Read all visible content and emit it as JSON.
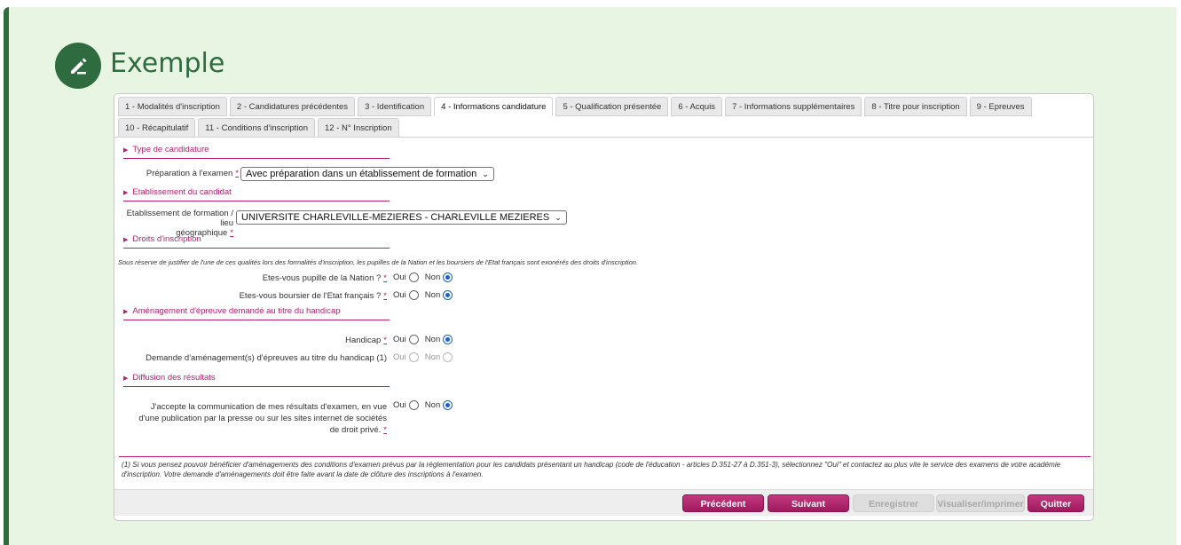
{
  "callout": {
    "title": "Exemple",
    "icon": "pencil-icon"
  },
  "tabs": [
    [
      "1 - Modalités d'inscription",
      "2 - Candidatures précédentes",
      "3 - Identification",
      "4 - Informations candidature",
      "5 - Qualification présentée",
      "6 - Acquis",
      "7 - Informations supplémentaires",
      "8 - Titre pour inscription",
      "9 - Epreuves"
    ],
    [
      "10 - Récapitulatif",
      "11 - Conditions d'inscription",
      "12 - N° Inscription"
    ]
  ],
  "active_tab": "4 - Informations candidature",
  "sections": {
    "type": "Type de candidature",
    "etab": "Etablissement du candidat",
    "droits": "Droits d'inscription",
    "amenagement": "Aménagement d'épreuve demandé au titre du handicap",
    "diffusion": "Diffusion des résultats"
  },
  "fields": {
    "preparation_label": "Préparation à l'examen",
    "preparation_value": "Avec préparation dans un établissement de formation",
    "etab_label_1": "Etablissement de formation / lieu",
    "etab_label_2": "géographique",
    "etab_value": "UNIVERSITE CHARLEVILLE-MEZIERES - CHARLEVILLE MEZIERES",
    "droits_note": "Sous réserve de justifier de l'une de ces qualités lors des formalités d'inscription, les pupilles de la Nation et les boursiers de l'Etat français sont exonérés des droits d'inscription.",
    "pupille_label": "Etes-vous pupille de la Nation ?",
    "boursier_label": "Etes-vous boursier de l'Etat français ?",
    "handicap_label": "Handicap",
    "demande_label": "Demande d'aménagement(s) d'épreuves au titre du handicap (1)",
    "diffusion_label_1": "J'accepte la communication de mes résultats d'examen, en vue",
    "diffusion_label_2": "d'une publication par la presse ou sur les sites internet de sociétés",
    "diffusion_label_3": "de droit privé."
  },
  "radio": {
    "oui": "Oui",
    "non": "Non",
    "required_mark": "*"
  },
  "footnote": "(1) Si vous pensez pouvoir bénéficier d'aménagements des conditions d'examen prévus par la réglementation pour les candidats présentant un handicap (code de l'éducation - articles D.351-27 à D.351-3), sélectionnez \"Oui\" et contactez au plus vite le service des examens de votre académie d'inscription. Votre demande d'aménagements doit être faite avant la date de clôture des inscriptions à l'examen.",
  "buttons": {
    "prev": "Précédent",
    "next": "Suivant",
    "save": "Enregistrer",
    "print": "Visualiser/imprimer",
    "quit": "Quitter"
  },
  "colors": {
    "accent": "#b4226f",
    "callout_bg": "#e8f5e2",
    "callout_green": "#2e6b3f",
    "radio_checked": "#1a5fd6"
  }
}
